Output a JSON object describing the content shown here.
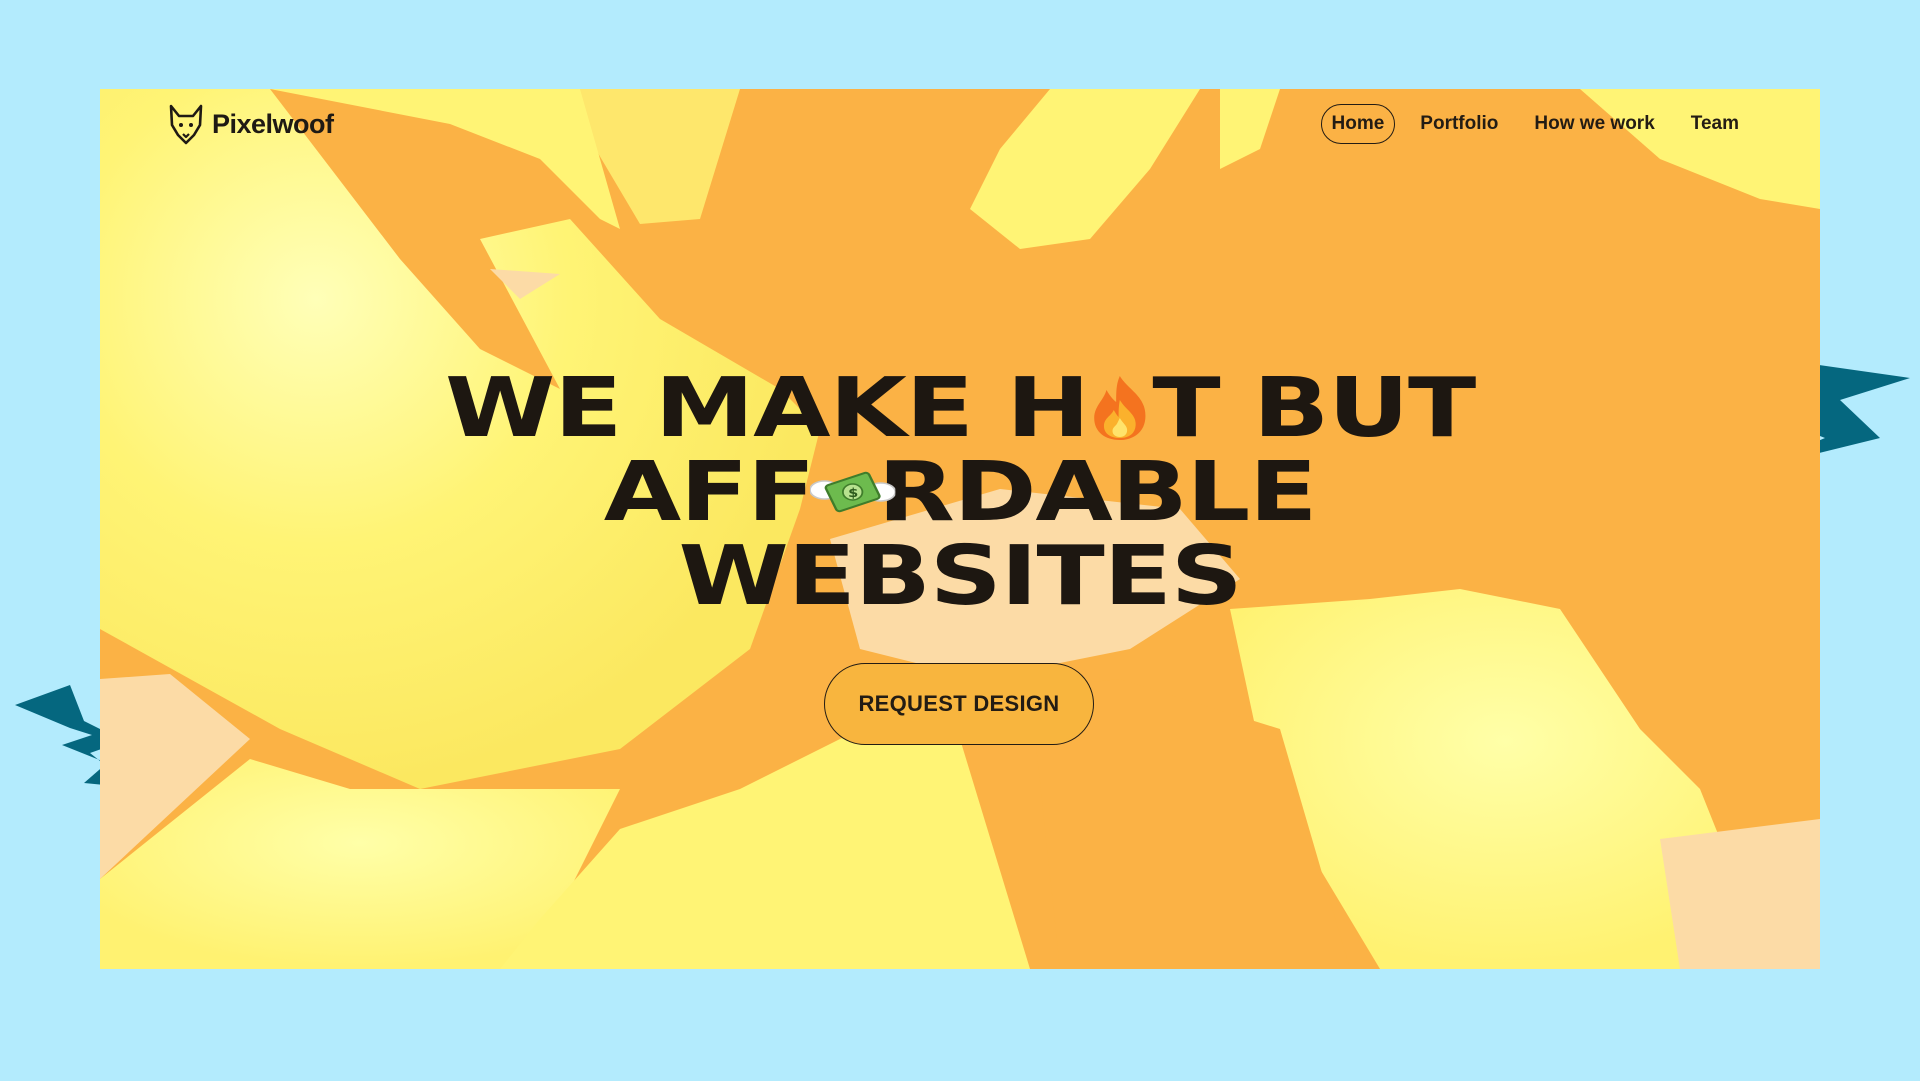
{
  "brand": {
    "name": "Pixelwoof",
    "logo_icon": "fox-head-icon"
  },
  "nav": {
    "items": [
      {
        "label": "Home",
        "active": true
      },
      {
        "label": "Portfolio",
        "active": false
      },
      {
        "label": "How we work",
        "active": false
      },
      {
        "label": "Team",
        "active": false
      }
    ]
  },
  "hero": {
    "line1_pre": "WE MAKE H",
    "line1_emoji": "fire-emoji",
    "line1_post": "T BUT",
    "line2_pre": "AFF",
    "line2_emoji": "money-with-wings-emoji",
    "line2_post": "RDABLE",
    "line3": "WEBSITES",
    "cta_label": "REQUEST DESIGN"
  },
  "colors": {
    "page_background": "#b3ebfd",
    "hero_orange": "#fbb245",
    "hero_yellow": "#fff475",
    "hero_peach": "#fcdba6",
    "accent_teal": "#05677f",
    "text_dark": "#1d1711"
  }
}
